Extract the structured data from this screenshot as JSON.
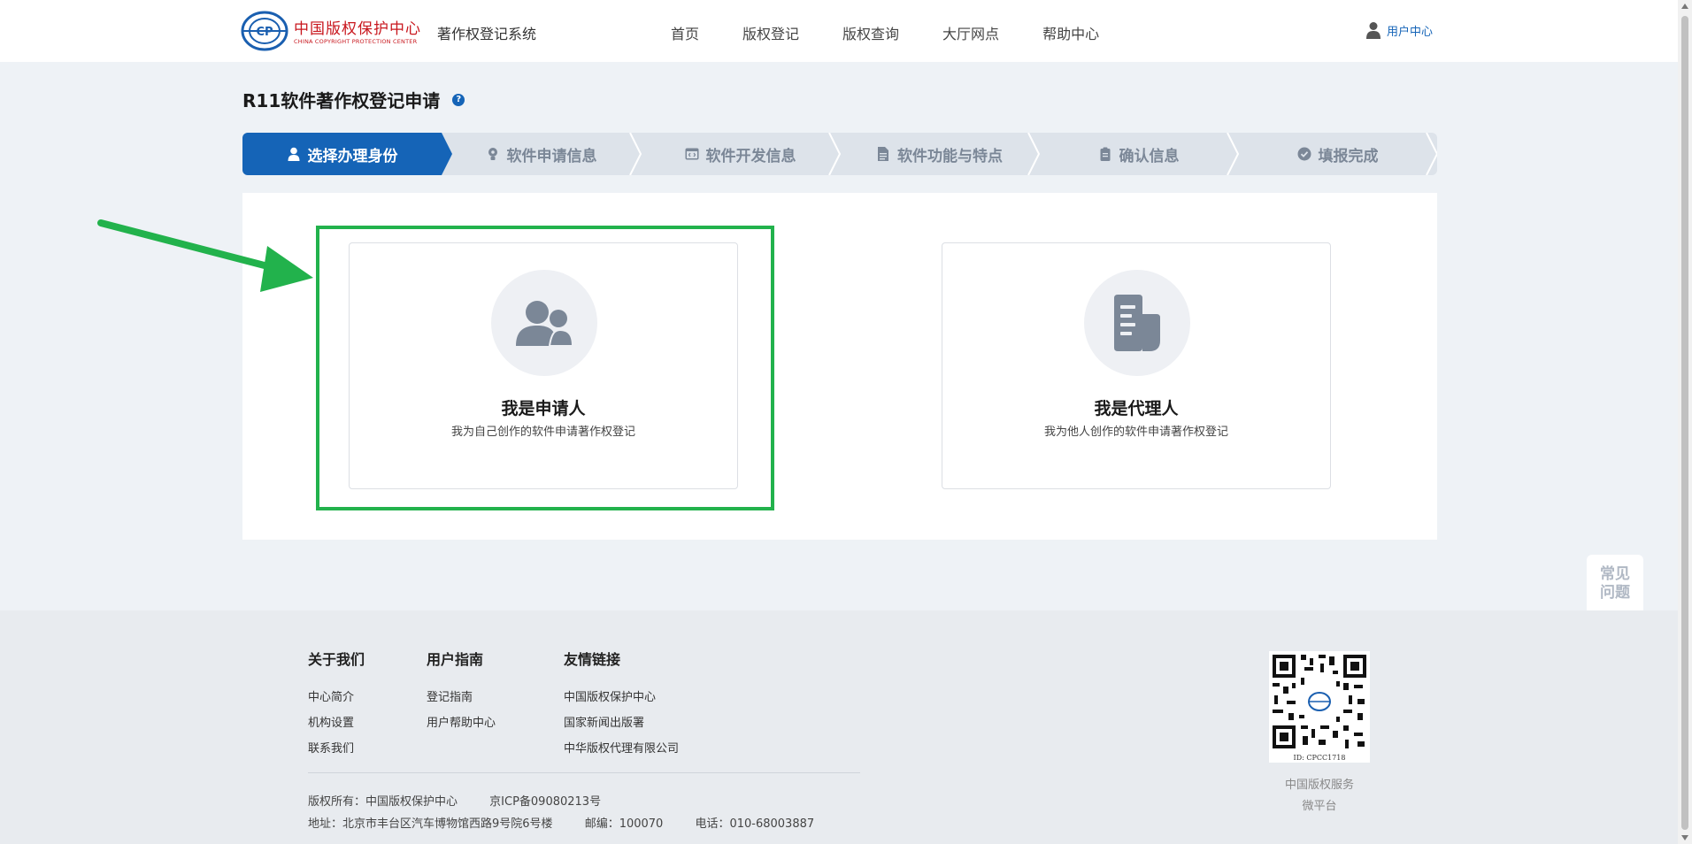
{
  "header": {
    "logo_cn": "中国版权保护中心",
    "logo_en": "CHINA COPYRIGHT PROTECTION CENTER",
    "system_title": "著作权登记系统",
    "nav": [
      "首页",
      "版权登记",
      "版权查询",
      "大厅网点",
      "帮助中心"
    ],
    "user_center": "用户中心"
  },
  "page": {
    "title": "R11软件著作权登记申请",
    "help": "?"
  },
  "steps": [
    {
      "label": "选择办理身份",
      "icon": "user-icon",
      "active": true
    },
    {
      "label": "软件申请信息",
      "icon": "bulb-icon",
      "active": false
    },
    {
      "label": "软件开发信息",
      "icon": "code-icon",
      "active": false
    },
    {
      "label": "软件功能与特点",
      "icon": "document-icon",
      "active": false
    },
    {
      "label": "确认信息",
      "icon": "clipboard-icon",
      "active": false
    },
    {
      "label": "填报完成",
      "icon": "check-circle-icon",
      "active": false
    }
  ],
  "cards": {
    "applicant": {
      "title": "我是申请人",
      "subtitle": "我为自己创作的软件申请著作权登记"
    },
    "agent": {
      "title": "我是代理人",
      "subtitle": "我为他人创作的软件申请著作权登记"
    }
  },
  "float_widget": {
    "faq_line1": "常见",
    "faq_line2": "问题"
  },
  "footer": {
    "columns": [
      {
        "title": "关于我们",
        "links": [
          "中心简介",
          "机构设置",
          "联系我们"
        ]
      },
      {
        "title": "用户指南",
        "links": [
          "登记指南",
          "用户帮助中心"
        ]
      },
      {
        "title": "友情链接",
        "links": [
          "中国版权保护中心",
          "国家新闻出版署",
          "中华版权代理有限公司"
        ]
      }
    ],
    "copyright": "版权所有：中国版权保护中心",
    "icp": "京ICP备09080213号",
    "address": "地址：北京市丰台区汽车博物馆西路9号院6号楼",
    "postcode": "邮编：100070",
    "phone": "电话：010-68003887",
    "qr_id": "ID: CPCC1718",
    "qr_label_1": "中国版权服务",
    "qr_label_2": "微平台"
  },
  "colors": {
    "primary": "#1564b7",
    "highlight": "#22b24c",
    "logo_red": "#c8161d"
  }
}
